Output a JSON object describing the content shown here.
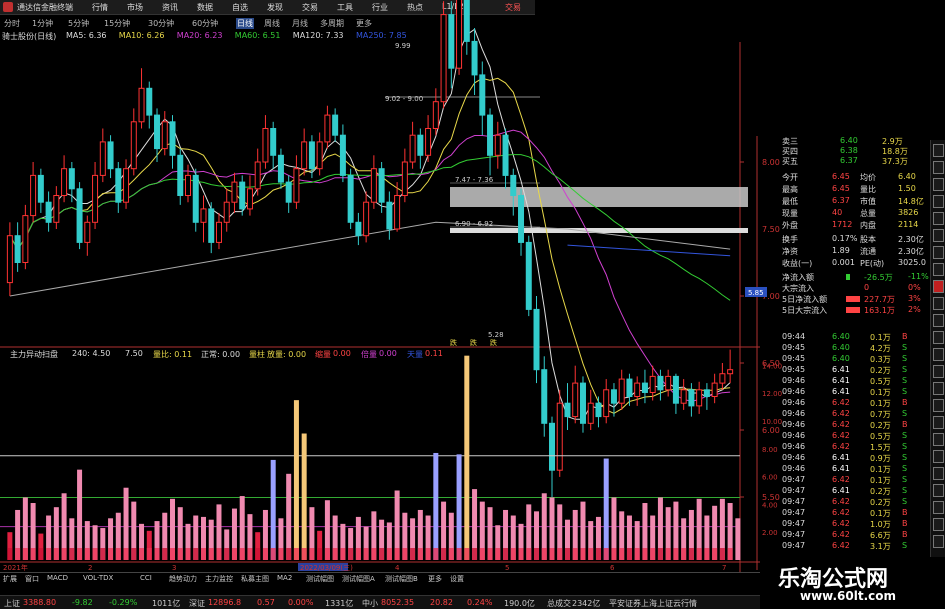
{
  "window": {
    "title": "通达信金融终端",
    "menu_items": [
      "行情",
      "市场",
      "资讯",
      "数据",
      "自选",
      "发现",
      "交易",
      "工具",
      "行业",
      "热点",
      "L1/L2"
    ],
    "trade_button": "交易"
  },
  "period_tabs": {
    "items": [
      "分时",
      "1分钟",
      "5分钟",
      "15分钟",
      "30分钟",
      "60分钟",
      "日线",
      "周线",
      "月线",
      "多周期",
      "更多"
    ],
    "active": "日线"
  },
  "price_header": {
    "stock": "骑士股份(日线)",
    "ma": [
      {
        "label": "MA5: 6.36",
        "color": "#dddddd"
      },
      {
        "label": "MA10: 6.26",
        "color": "#e8d84a"
      },
      {
        "label": "MA20: 6.23",
        "color": "#d040d0"
      },
      {
        "label": "MA60: 6.51",
        "color": "#33cc33"
      },
      {
        "label": "MA120: 7.33",
        "color": "#dddddd"
      },
      {
        "label": "MA250: 7.85",
        "color": "#3355dd"
      }
    ]
  },
  "chart_data": {
    "type": "candlestick",
    "price_axis": {
      "ticks": [
        "8.00",
        "7.50",
        "7.00",
        "6.50",
        "6.00",
        "5.50"
      ]
    },
    "price_callouts": [
      "9.99",
      "9.02 - 9.00",
      "7.47 - 7.36",
      "6.90 - 6.92",
      "5.28"
    ],
    "current_price_label": "5.85",
    "markers": [
      "跌",
      "跌",
      "跌"
    ],
    "candles": [
      [
        7.1,
        7.45,
        7.55,
        7.0
      ],
      [
        7.45,
        7.25,
        7.55,
        7.18
      ],
      [
        7.25,
        7.6,
        7.68,
        7.2
      ],
      [
        7.6,
        7.9,
        8.0,
        7.55
      ],
      [
        7.9,
        7.7,
        7.95,
        7.62
      ],
      [
        7.7,
        7.55,
        7.78,
        7.48
      ],
      [
        7.55,
        7.75,
        7.82,
        7.5
      ],
      [
        7.75,
        7.95,
        8.05,
        7.7
      ],
      [
        7.95,
        7.8,
        8.0,
        7.7
      ],
      [
        7.8,
        7.4,
        7.85,
        7.35
      ],
      [
        7.4,
        7.55,
        7.6,
        7.3
      ],
      [
        7.55,
        7.9,
        8.0,
        7.5
      ],
      [
        7.9,
        8.15,
        8.25,
        7.85
      ],
      [
        8.15,
        7.95,
        8.2,
        7.88
      ],
      [
        7.95,
        7.7,
        8.0,
        7.62
      ],
      [
        7.7,
        7.95,
        8.02,
        7.65
      ],
      [
        7.95,
        8.3,
        8.4,
        7.9
      ],
      [
        8.3,
        8.55,
        8.7,
        8.25
      ],
      [
        8.55,
        8.35,
        8.6,
        8.25
      ],
      [
        8.35,
        8.1,
        8.4,
        8.0
      ],
      [
        8.1,
        8.3,
        8.38,
        8.05
      ],
      [
        8.3,
        8.05,
        8.35,
        7.95
      ],
      [
        8.05,
        7.75,
        8.1,
        7.68
      ],
      [
        7.75,
        7.9,
        7.98,
        7.7
      ],
      [
        7.9,
        7.55,
        7.95,
        7.48
      ],
      [
        7.55,
        7.65,
        7.75,
        7.4
      ],
      [
        7.65,
        7.4,
        7.7,
        7.32
      ],
      [
        7.4,
        7.55,
        7.62,
        7.35
      ],
      [
        7.55,
        7.7,
        7.8,
        7.48
      ],
      [
        7.7,
        7.85,
        7.92,
        7.62
      ],
      [
        7.85,
        7.65,
        7.9,
        7.6
      ],
      [
        7.65,
        7.8,
        7.9,
        7.6
      ],
      [
        7.8,
        8.0,
        8.1,
        7.75
      ],
      [
        8.0,
        8.25,
        8.35,
        7.95
      ],
      [
        8.25,
        8.05,
        8.3,
        7.95
      ],
      [
        8.05,
        7.85,
        8.1,
        7.8
      ],
      [
        7.85,
        7.7,
        7.9,
        7.62
      ],
      [
        7.7,
        7.95,
        8.05,
        7.65
      ],
      [
        7.95,
        8.15,
        8.25,
        7.9
      ],
      [
        8.15,
        7.95,
        8.2,
        7.88
      ],
      [
        7.95,
        8.15,
        8.22,
        7.9
      ],
      [
        8.15,
        8.35,
        8.42,
        8.1
      ],
      [
        8.35,
        8.2,
        8.4,
        8.15
      ],
      [
        8.2,
        7.9,
        8.28,
        7.85
      ],
      [
        7.9,
        7.55,
        7.95,
        7.5
      ],
      [
        7.55,
        7.45,
        7.62,
        7.38
      ],
      [
        7.45,
        7.7,
        7.78,
        7.4
      ],
      [
        7.7,
        7.95,
        8.05,
        7.65
      ],
      [
        7.95,
        7.7,
        8.0,
        7.62
      ],
      [
        7.7,
        7.5,
        7.78,
        7.42
      ],
      [
        7.5,
        7.75,
        7.85,
        7.48
      ],
      [
        7.75,
        8.0,
        8.1,
        7.7
      ],
      [
        8.0,
        8.2,
        8.3,
        7.95
      ],
      [
        8.2,
        8.05,
        8.25,
        7.95
      ],
      [
        8.05,
        8.25,
        8.35,
        8.0
      ],
      [
        8.25,
        8.45,
        8.55,
        8.2
      ],
      [
        8.45,
        9.1,
        9.2,
        8.4
      ],
      [
        9.1,
        8.7,
        9.2,
        8.55
      ],
      [
        8.7,
        9.6,
        9.99,
        8.65
      ],
      [
        9.6,
        8.9,
        9.7,
        8.8
      ],
      [
        8.9,
        8.65,
        9.0,
        8.5
      ],
      [
        8.65,
        8.35,
        8.75,
        8.2
      ],
      [
        8.35,
        8.05,
        8.4,
        7.9
      ],
      [
        8.05,
        8.2,
        8.3,
        7.95
      ],
      [
        8.2,
        7.9,
        8.25,
        7.8
      ],
      [
        7.9,
        7.75,
        7.95,
        7.6
      ],
      [
        7.75,
        7.4,
        7.8,
        7.3
      ],
      [
        7.4,
        6.9,
        7.45,
        6.85
      ],
      [
        6.9,
        6.45,
        7.0,
        6.35
      ],
      [
        6.45,
        6.05,
        6.55,
        5.95
      ],
      [
        6.05,
        5.7,
        6.1,
        5.28
      ],
      [
        5.7,
        6.2,
        6.3,
        5.65
      ],
      [
        6.2,
        6.1,
        6.35,
        6.0
      ],
      [
        6.1,
        6.35,
        6.48,
        6.05
      ],
      [
        6.35,
        6.05,
        6.4,
        5.98
      ],
      [
        6.05,
        6.2,
        6.3,
        6.0
      ],
      [
        6.2,
        6.1,
        6.25,
        6.02
      ],
      [
        6.1,
        6.3,
        6.38,
        6.05
      ],
      [
        6.3,
        6.2,
        6.35,
        6.1
      ],
      [
        6.2,
        6.38,
        6.45,
        6.15
      ],
      [
        6.38,
        6.25,
        6.42,
        6.18
      ],
      [
        6.25,
        6.35,
        6.4,
        6.18
      ],
      [
        6.35,
        6.28,
        6.45,
        6.2
      ],
      [
        6.28,
        6.4,
        6.48,
        6.22
      ],
      [
        6.4,
        6.3,
        6.45,
        6.22
      ],
      [
        6.3,
        6.4,
        6.45,
        6.25
      ],
      [
        6.4,
        6.2,
        6.42,
        6.12
      ],
      [
        6.2,
        6.3,
        6.38,
        6.15
      ],
      [
        6.3,
        6.18,
        6.35,
        6.1
      ],
      [
        6.18,
        6.3,
        6.36,
        6.12
      ],
      [
        6.3,
        6.25,
        6.35,
        6.15
      ],
      [
        6.25,
        6.35,
        6.42,
        6.2
      ],
      [
        6.35,
        6.42,
        6.5,
        6.3
      ],
      [
        6.42,
        6.45,
        6.6,
        6.35
      ]
    ],
    "volume": {
      "axis_ticks": [
        "14.00",
        "12.00",
        "10.00",
        "8.00",
        "6.00",
        "4.00",
        "2.00"
      ],
      "values": [
        2.0,
        3.6,
        4.5,
        4.1,
        1.9,
        3.2,
        3.8,
        4.8,
        3.0,
        6.5,
        2.8,
        2.5,
        2.3,
        3.0,
        3.4,
        5.2,
        4.2,
        2.6,
        2.1,
        2.8,
        3.4,
        4.4,
        3.8,
        2.6,
        3.2,
        3.1,
        2.9,
        4.0,
        2.2,
        3.7,
        4.6,
        3.3,
        2.0,
        3.6,
        7.2,
        3.0,
        6.2,
        11.5,
        9.1,
        3.8,
        2.1,
        4.3,
        3.2,
        2.6,
        2.3,
        3.1,
        2.4,
        3.5,
        2.9,
        2.7,
        5.0,
        3.4,
        3.0,
        3.6,
        3.2,
        7.7,
        4.2,
        3.4,
        7.6,
        14.7,
        5.1,
        4.2,
        3.8,
        2.5,
        3.6,
        3.2,
        2.6,
        4.0,
        3.5,
        4.8,
        4.5,
        4.0,
        2.9,
        3.6,
        4.2,
        2.8,
        3.1,
        7.3,
        4.5,
        3.5,
        3.2,
        2.8,
        4.1,
        3.2,
        4.5,
        3.8,
        4.2,
        3.0,
        3.6,
        4.4,
        3.2,
        3.9,
        4.4,
        4.1,
        3.0
      ]
    }
  },
  "volume_header": {
    "label": "主力异动扫盘",
    "items": [
      {
        "t": "240: 4.50",
        "c": "#dddddd"
      },
      {
        "t": "7.50",
        "c": "#dddddd"
      },
      {
        "t": "量比: 0.11",
        "c": "#e8d84a"
      },
      {
        "t": "正常: 0.00",
        "c": "#dddddd"
      },
      {
        "t": "量柱",
        "c": "#e8d84a"
      },
      {
        "t": "放量: 0.00",
        "c": "#e8d84a"
      },
      {
        "t": "缩量",
        "c": "#ff4444"
      },
      {
        "t": "0.00",
        "c": "#ff4444"
      },
      {
        "t": "倍量",
        "c": "#d040d0"
      },
      {
        "t": "0.00",
        "c": "#d040d0"
      },
      {
        "t": "天量",
        "c": "#3355dd"
      },
      {
        "t": "0.11",
        "c": "#ff4444"
      }
    ]
  },
  "time_axis": [
    "2021年",
    "2",
    "3",
    "2022/03/09(三)",
    "4",
    "5",
    "6",
    "7"
  ],
  "bottom_tabs": [
    "扩展",
    "窗口",
    "MACD",
    "VOL-TDX",
    "CCI",
    "趋势动力",
    "主力监控",
    "私募主图",
    "MA2",
    "测试幅图",
    "测试幅图A",
    "测试幅图B",
    "更多",
    "设置"
  ],
  "quote_panel": {
    "asks": [
      [
        "卖三",
        "6.40",
        "2.9万"
      ],
      [
        "买四",
        "6.38",
        "18.8万"
      ],
      [
        "买五",
        "6.37",
        "37.3万"
      ]
    ],
    "stats": [
      [
        "今开",
        "6.45",
        "均价",
        "6.40"
      ],
      [
        "最高",
        "6.45",
        "量比",
        "1.50"
      ],
      [
        "最低",
        "6.37",
        "市值",
        "14.8亿"
      ],
      [
        "现量",
        "40",
        "总量",
        "3826"
      ],
      [
        "外盘",
        "1712",
        "内盘",
        "2114"
      ]
    ],
    "more": [
      [
        "换手",
        "0.17%",
        "股本",
        "2.30亿"
      ],
      [
        "净资",
        "1.89",
        "流通",
        "2.30亿"
      ],
      [
        "收益(一)",
        "0.001",
        "PE(动)",
        "3025.0"
      ]
    ],
    "flows": [
      [
        "净流入额",
        "-26.5万",
        "-11%"
      ],
      [
        "大宗流入",
        "0",
        "0%"
      ],
      [
        "5日净流入额",
        "227.7万",
        "3%"
      ],
      [
        "5日大宗流入",
        "163.1万",
        "2%"
      ]
    ]
  },
  "ticks": [
    [
      "09:44",
      "6.40",
      "0.1万",
      "B"
    ],
    [
      "09:45",
      "6.40",
      "4.2万",
      "S"
    ],
    [
      "09:45",
      "6.40",
      "0.3万",
      "S"
    ],
    [
      "09:45",
      "6.41",
      "0.2万",
      "S"
    ],
    [
      "09:46",
      "6.41",
      "0.5万",
      "S"
    ],
    [
      "09:46",
      "6.41",
      "0.1万",
      "S"
    ],
    [
      "09:46",
      "6.42",
      "0.1万",
      "B"
    ],
    [
      "09:46",
      "6.42",
      "0.7万",
      "S"
    ],
    [
      "09:46",
      "6.42",
      "0.2万",
      "B"
    ],
    [
      "09:46",
      "6.42",
      "0.5万",
      "S"
    ],
    [
      "09:46",
      "6.42",
      "1.5万",
      "S"
    ],
    [
      "09:46",
      "6.41",
      "0.9万",
      "S"
    ],
    [
      "09:46",
      "6.41",
      "0.1万",
      "S"
    ],
    [
      "09:47",
      "6.42",
      "0.1万",
      "S"
    ],
    [
      "09:47",
      "6.41",
      "0.2万",
      "S"
    ],
    [
      "09:47",
      "6.42",
      "0.2万",
      "S"
    ],
    [
      "09:47",
      "6.42",
      "0.1万",
      "B"
    ],
    [
      "09:47",
      "6.42",
      "1.0万",
      "B"
    ],
    [
      "09:47",
      "6.42",
      "6.6万",
      "B"
    ],
    [
      "09:47",
      "6.42",
      "3.1万",
      "S"
    ]
  ],
  "status_bar": {
    "items": [
      {
        "t": "上证",
        "c": "#cccccc"
      },
      {
        "t": "3388.80",
        "c": "#ff4444"
      },
      {
        "t": "-9.82",
        "c": "#33cc33"
      },
      {
        "t": "-0.29%",
        "c": "#33cc33"
      },
      {
        "t": "1011亿",
        "c": "#cccccc"
      },
      {
        "t": "深证",
        "c": "#cccccc"
      },
      {
        "t": "12896.8",
        "c": "#ff4444"
      },
      {
        "t": "0.57",
        "c": "#ff4444"
      },
      {
        "t": "0.00%",
        "c": "#ff4444"
      },
      {
        "t": "1331亿",
        "c": "#cccccc"
      },
      {
        "t": "中小",
        "c": "#cccccc"
      },
      {
        "t": "8052.35",
        "c": "#ff4444"
      },
      {
        "t": "20.82",
        "c": "#ff4444"
      },
      {
        "t": "0.24%",
        "c": "#ff4444"
      },
      {
        "t": "190.0亿",
        "c": "#cccccc"
      },
      {
        "t": "总成交",
        "c": "#cccccc"
      },
      {
        "t": "2342亿",
        "c": "#cccccc"
      },
      {
        "t": "平安证券上海上证云行情",
        "c": "#cccccc"
      }
    ]
  },
  "watermark": {
    "line1": "乐淘公式网",
    "line2": "www.60lt.com"
  },
  "colors": {
    "up": "#ff3333",
    "down": "#33cccc",
    "ma5": "#dddddd",
    "ma10": "#e8d84a",
    "ma20": "#d040d0",
    "ma60": "#33cc33",
    "ma250": "#3355dd"
  }
}
